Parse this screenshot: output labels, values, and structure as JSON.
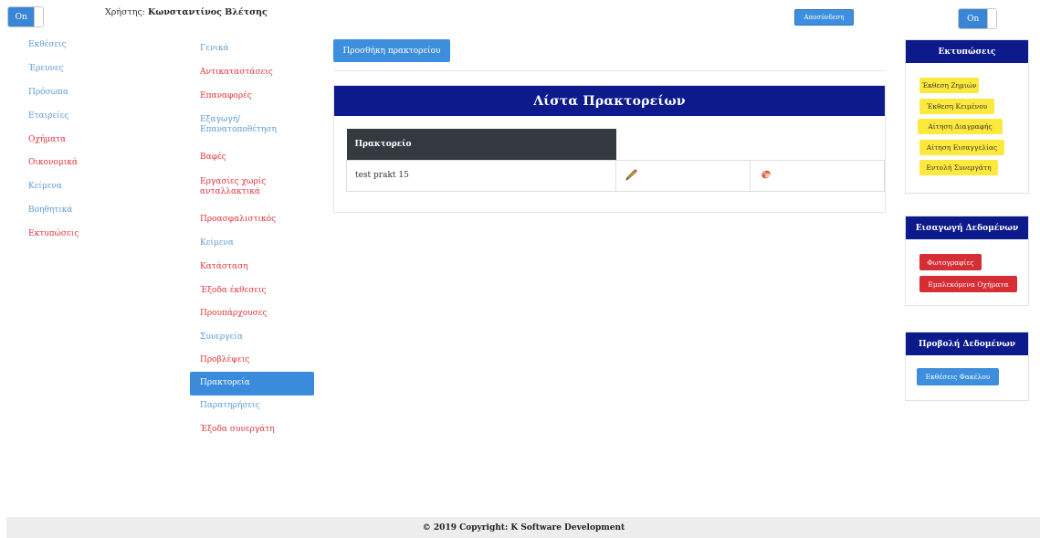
{
  "toggles": {
    "left_label": "On",
    "right_label": "On"
  },
  "user": {
    "prefix": "Χρήστης:",
    "name": "Κωνσταντίνος Βλέτσης"
  },
  "logout_label": "Αποσύνδεση",
  "main_nav": [
    {
      "label": "Εκθέσεις",
      "color": "blue"
    },
    {
      "label": "Έρευνες",
      "color": "blue"
    },
    {
      "label": "Πρόσωπα",
      "color": "blue"
    },
    {
      "label": "Εταιρείες",
      "color": "blue"
    },
    {
      "label": "Οχήματα",
      "color": "red"
    },
    {
      "label": "Οικονομικά",
      "color": "red"
    },
    {
      "label": "Κείμενα",
      "color": "blue"
    },
    {
      "label": "Βοηθητικά",
      "color": "blue"
    },
    {
      "label": "Εκτυπώσεις",
      "color": "red"
    }
  ],
  "sub_nav": [
    {
      "label": "Γενικά",
      "color": "blue"
    },
    {
      "label": "Αντικαταστάσεις",
      "color": "red"
    },
    {
      "label": "Επαναφορές",
      "color": "red"
    },
    {
      "label": "Εξαγωγή/ Επανατοποθέτηση",
      "color": "blue"
    },
    {
      "label": "Βαφές",
      "color": "red"
    },
    {
      "label": "Εργασίες χωρίς ανταλλακτικά",
      "color": "red"
    },
    {
      "label": "Προασφαλιστικός",
      "color": "red"
    },
    {
      "label": "Κείμενα",
      "color": "blue"
    },
    {
      "label": "Κατάσταση",
      "color": "red"
    },
    {
      "label": "Έξοδα έκθεσεις",
      "color": "red"
    },
    {
      "label": "Προυπάρχουσες",
      "color": "red"
    },
    {
      "label": "Συνεργεία",
      "color": "blue"
    },
    {
      "label": "Προβλέψεις",
      "color": "red"
    },
    {
      "label": "Πρακτορεία",
      "color": "active"
    },
    {
      "label": "Παρατηρήσεις",
      "color": "blue"
    },
    {
      "label": "Έξοδα συνεργάτη",
      "color": "red"
    }
  ],
  "add_button_label": "Προσθήκη πρακτορείου",
  "list": {
    "title": "Λίστα Πρακτορείων",
    "column_header": "Πρακτορείο",
    "rows": [
      {
        "name": "test prakt 15",
        "edit_icon": "pencil-icon",
        "delete_icon": "eraser-icon"
      }
    ]
  },
  "print_panel": {
    "title": "Εκτυπώσεις",
    "buttons": [
      "Έκθεση Ζημιών",
      "Έκθεση Κειμένου",
      "Αίτηση Διαγραφής",
      "Αίτηση Εισαγγελίας",
      "Εντολή Συνεργάτη"
    ]
  },
  "import_panel": {
    "title": "Εισαγωγή Δεδομένων",
    "buttons": [
      "Φωτογραφίες",
      "Εμπλεκόμενα Οχήματα"
    ]
  },
  "view_panel": {
    "title": "Προβολή Δεδομένων",
    "buttons": [
      "Εκθέσεις Φακέλου"
    ]
  },
  "footer": "© 2019 Copyright: K Software Development",
  "colors": {
    "brand_navy": "#0c1a8c",
    "primary_blue": "#3d8fde",
    "link_red": "#e0333b",
    "link_blue": "#5b9bd5",
    "chip_yellow": "#fde93d",
    "danger_red": "#d62e35"
  }
}
